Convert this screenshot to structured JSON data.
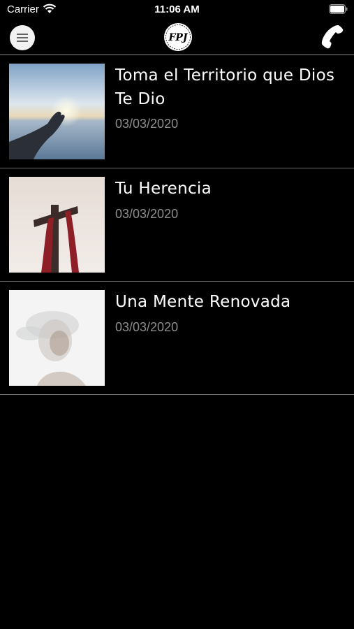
{
  "status_bar": {
    "carrier": "Carrier",
    "time": "11:06 AM"
  },
  "nav_bar": {
    "logo_text": "FPJ",
    "menu_icon": "hamburger-icon",
    "phone_icon": "phone-icon"
  },
  "items": [
    {
      "title": "Toma el Territorio que Dios Te Dio",
      "date": "03/03/2020",
      "image": "hand-reaching-sunset"
    },
    {
      "title": "Tu Herencia",
      "date": "03/03/2020",
      "image": "cross-red-cloth"
    },
    {
      "title": "Una Mente Renovada",
      "date": "03/03/2020",
      "image": "faded-portrait"
    }
  ],
  "colors": {
    "background": "#000000",
    "text": "#ffffff",
    "date": "#8d8d8d",
    "divider": "#6d6d6d"
  }
}
